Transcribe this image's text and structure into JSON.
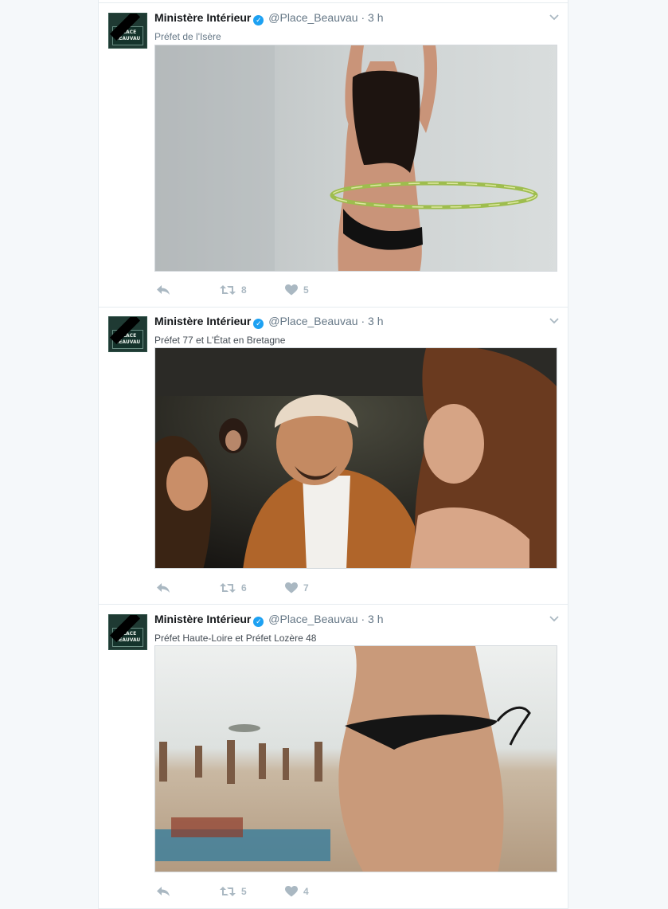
{
  "tweets": [
    {
      "author": "Ministère Intérieur",
      "handle": "@Place_Beauvau",
      "separator": "·",
      "time": "3 h",
      "avatar_text": "PLACE BEAUVAU",
      "reply_to": "Préfet de l'Isère",
      "media_description": "hula-hoop",
      "retweets": "8",
      "likes": "5"
    },
    {
      "author": "Ministère Intérieur",
      "handle": "@Place_Beauvau",
      "separator": "·",
      "time": "3 h",
      "avatar_text": "PLACE BEAUVAU",
      "reply_to": "Préfet 77 et L'État en Bretagne",
      "media_description": "party",
      "retweets": "6",
      "likes": "7"
    },
    {
      "author": "Ministère Intérieur",
      "handle": "@Place_Beauvau",
      "separator": "·",
      "time": "3 h",
      "avatar_text": "PLACE BEAUVAU",
      "reply_to": "Préfet Haute-Loire et Préfet Lozère 48",
      "media_description": "beach",
      "retweets": "5",
      "likes": "4"
    }
  ],
  "icons": {
    "verified": "verified-badge-icon",
    "chevron": "chevron-down-icon",
    "reply": "reply-icon",
    "retweet": "retweet-icon",
    "like": "heart-icon"
  },
  "colors": {
    "verified": "#1da1f2",
    "action": "#aab8c2",
    "secondary_text": "#657786"
  }
}
